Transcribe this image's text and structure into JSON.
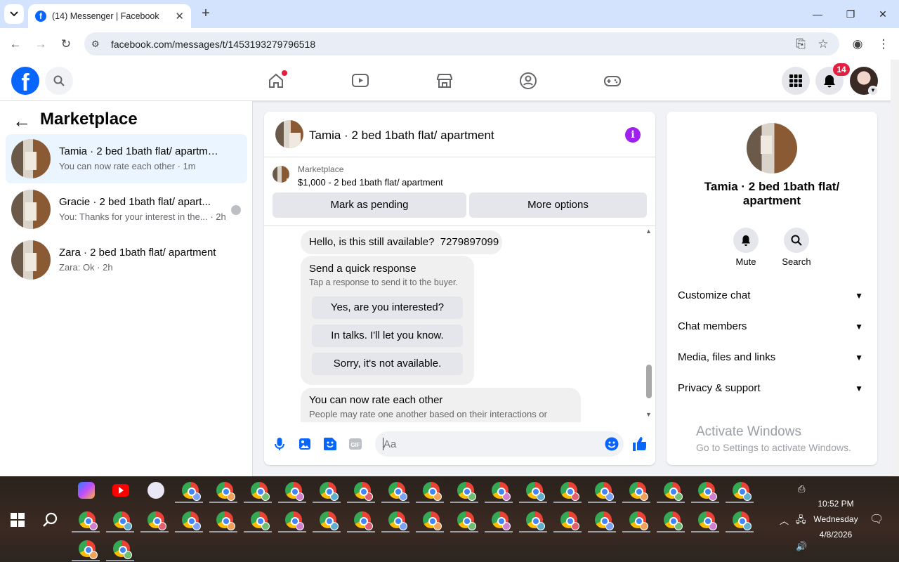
{
  "browser": {
    "tab_title": "(14) Messenger | Facebook",
    "url": "facebook.com/messages/t/1453193279796518"
  },
  "header": {
    "notif_count": "14",
    "colors": {
      "brand": "#0866ff",
      "badge": "#e41e3f"
    }
  },
  "left_panel": {
    "title": "Marketplace",
    "conversations": [
      {
        "name": "Tamia · 2 bed 1bath flat/ apartment",
        "preview": "You can now rate each other · 1m",
        "selected": true
      },
      {
        "name": "Gracie · 2 bed 1bath flat/ apart...",
        "preview": "You: Thanks for your interest in the... · 2h"
      },
      {
        "name": "Zara · 2 bed 1bath flat/ apartment",
        "preview": "Zara: Ok · 2h"
      }
    ]
  },
  "chat": {
    "title": "Tamia · 2 bed 1bath flat/ apartment",
    "marketplace_label": "Marketplace",
    "listing": "$1,000 - 2 bed 1bath flat/ apartment",
    "buttons": {
      "pending": "Mark as pending",
      "more": "More options"
    },
    "messages": {
      "first": "Hello, is this still available?  7279897099",
      "quick_title": "Send a quick response",
      "quick_sub": "Tap a response to send it to the buyer.",
      "quick_options": [
        "Yes, are you interested?",
        "In talks. I'll let you know.",
        "Sorry, it's not available."
      ],
      "rate_title": "You can now rate each other",
      "rate_sub": "People may rate one another based on their interactions or"
    },
    "compose_placeholder": "Aa"
  },
  "right_panel": {
    "name": "Tamia · 2 bed 1bath flat/ apartment",
    "mute": "Mute",
    "search": "Search",
    "sections": [
      "Customize chat",
      "Chat members",
      "Media, files and links",
      "Privacy & support"
    ],
    "activate_title": "Activate Windows",
    "activate_sub": "Go to Settings to activate Windows."
  },
  "taskbar": {
    "time": "10:52 PM",
    "day": "Wednesday",
    "date": "4/8/2026"
  }
}
